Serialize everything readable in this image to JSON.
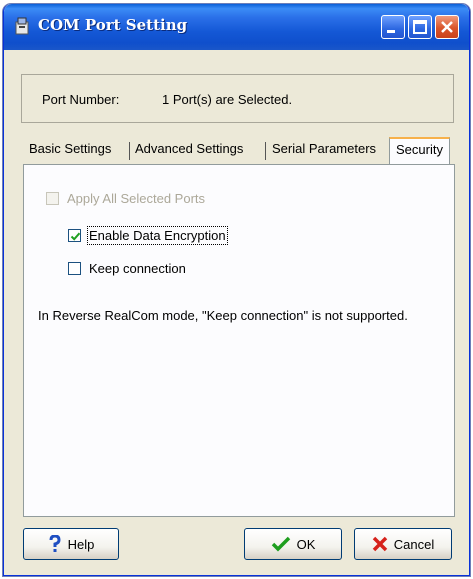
{
  "window": {
    "title": "COM Port Setting",
    "title_icon": "port-setting-icon",
    "controls": {
      "minimize": "minimize-icon",
      "maximize": "maximize-icon",
      "close": "close-icon"
    }
  },
  "port": {
    "label": "Port Number:",
    "value": "1 Port(s) are Selected."
  },
  "tabs": [
    {
      "label": "Basic Settings"
    },
    {
      "label": "Advanced Settings"
    },
    {
      "label": "Serial Parameters"
    },
    {
      "label": "Security",
      "active": true
    }
  ],
  "security": {
    "apply_all": {
      "label": "Apply All Selected Ports",
      "checked": false,
      "enabled": false
    },
    "encryption": {
      "label": "Enable Data Encryption",
      "checked": true,
      "enabled": true
    },
    "keep_connection": {
      "label": "Keep connection",
      "checked": false,
      "enabled": true
    },
    "note": "In Reverse RealCom mode, \"Keep connection\" is not supported."
  },
  "buttons": {
    "help": "Help",
    "ok": "OK",
    "cancel": "Cancel"
  },
  "colors": {
    "titlebar": "#1458d6",
    "dialog_bg": "#ECE9D8",
    "active_tab_accent": "#f7b14b"
  }
}
